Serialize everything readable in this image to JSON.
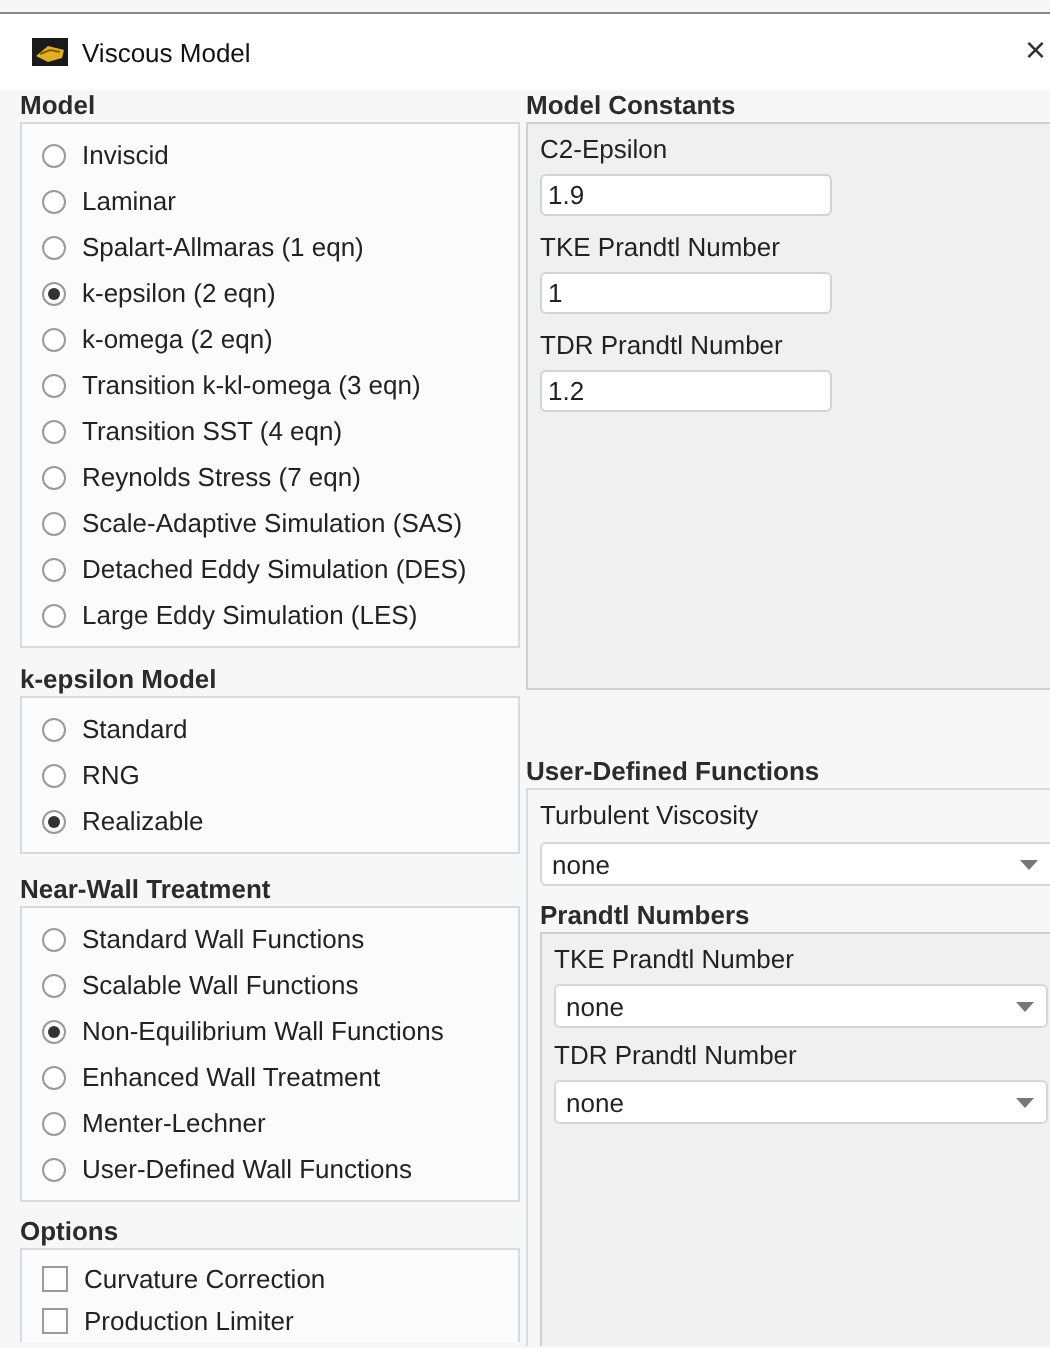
{
  "window": {
    "title": "Viscous Model",
    "close": "×"
  },
  "model": {
    "title": "Model",
    "options": [
      {
        "label": "Inviscid",
        "selected": false
      },
      {
        "label": "Laminar",
        "selected": false
      },
      {
        "label": "Spalart-Allmaras (1 eqn)",
        "selected": false
      },
      {
        "label": "k-epsilon (2 eqn)",
        "selected": true
      },
      {
        "label": "k-omega (2 eqn)",
        "selected": false
      },
      {
        "label": "Transition k-kl-omega (3 eqn)",
        "selected": false
      },
      {
        "label": "Transition SST (4 eqn)",
        "selected": false
      },
      {
        "label": "Reynolds Stress (7 eqn)",
        "selected": false
      },
      {
        "label": "Scale-Adaptive Simulation (SAS)",
        "selected": false
      },
      {
        "label": "Detached Eddy Simulation (DES)",
        "selected": false
      },
      {
        "label": "Large Eddy Simulation (LES)",
        "selected": false
      }
    ]
  },
  "k_epsilon_model": {
    "title": "k-epsilon Model",
    "options": [
      {
        "label": "Standard",
        "selected": false
      },
      {
        "label": "RNG",
        "selected": false
      },
      {
        "label": "Realizable",
        "selected": true
      }
    ]
  },
  "near_wall_treatment": {
    "title": "Near-Wall Treatment",
    "options": [
      {
        "label": "Standard Wall Functions",
        "selected": false
      },
      {
        "label": "Scalable Wall Functions",
        "selected": false
      },
      {
        "label": "Non-Equilibrium Wall Functions",
        "selected": true
      },
      {
        "label": "Enhanced Wall Treatment",
        "selected": false
      },
      {
        "label": "Menter-Lechner",
        "selected": false
      },
      {
        "label": "User-Defined Wall Functions",
        "selected": false
      }
    ]
  },
  "options": {
    "title": "Options",
    "items": [
      {
        "label": "Curvature Correction",
        "checked": false
      },
      {
        "label": "Production Limiter",
        "checked": false
      }
    ]
  },
  "model_constants": {
    "title": "Model Constants",
    "fields": [
      {
        "label": "C2-Epsilon",
        "value": "1.9"
      },
      {
        "label": "TKE Prandtl Number",
        "value": "1"
      },
      {
        "label": "TDR Prandtl Number",
        "value": "1.2"
      }
    ]
  },
  "user_defined_functions": {
    "title": "User-Defined Functions",
    "turbulent_viscosity": {
      "label": "Turbulent Viscosity",
      "value": "none"
    },
    "prandtl_numbers": {
      "title": "Prandtl Numbers",
      "fields": [
        {
          "label": "TKE Prandtl Number",
          "value": "none"
        },
        {
          "label": "TDR Prandtl Number",
          "value": "none"
        }
      ]
    }
  }
}
